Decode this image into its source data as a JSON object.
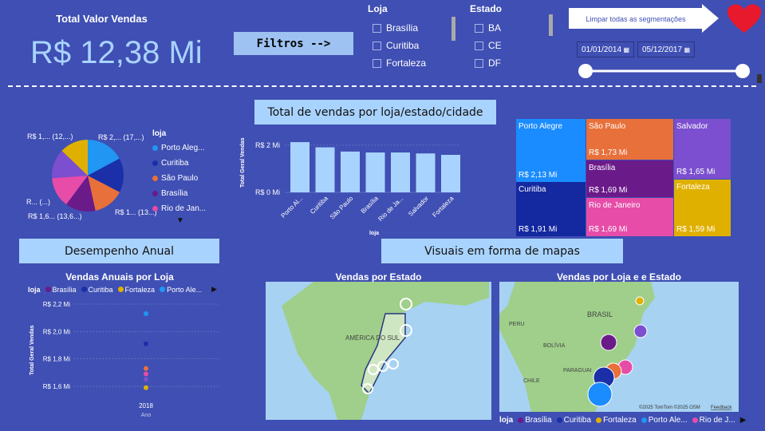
{
  "kpi": {
    "title": "Total Valor Vendas",
    "value": "R$ 12,38 Mi"
  },
  "filters_label": "Filtros -->",
  "slicer_loja": {
    "title": "Loja",
    "items": [
      "Brasília",
      "Curitiba",
      "Fortaleza"
    ]
  },
  "slicer_estado": {
    "title": "Estado",
    "items": [
      "BA",
      "CE",
      "DF"
    ]
  },
  "clear_button": "Limpar todas as segmentações",
  "date_from": "01/01/2014",
  "date_to": "05/12/2017",
  "sections": {
    "sales_by": "Total de vendas por loja/estado/cidade",
    "annual": "Desempenho Anual",
    "maps": "Visuais em forma de mapas"
  },
  "pie": {
    "legend_title": "loja",
    "legend": [
      {
        "name": "Porto Aleg...",
        "color": "#2196f3"
      },
      {
        "name": "Curitiba",
        "color": "#1a2fa8"
      },
      {
        "name": "São Paulo",
        "color": "#e8703a"
      },
      {
        "name": "Brasília",
        "color": "#6b1a8a"
      },
      {
        "name": "Rio de Jan...",
        "color": "#e64ca8"
      }
    ],
    "labels": [
      "R$ 1,... (12,...)",
      "R$ 2,... (17,...)",
      "R... (...)",
      "R$ 1,6... (13,6...)",
      "R$ 1... (13...)"
    ]
  },
  "chart_data": [
    {
      "type": "bar",
      "categories": [
        "Porto Al...",
        "Curitiba",
        "São Paulo",
        "Brasília",
        "Rio de Ja...",
        "Salvador",
        "Fortaleza"
      ],
      "values": [
        2.13,
        1.91,
        1.73,
        1.69,
        1.69,
        1.65,
        1.59
      ],
      "xlabel": "loja",
      "ylabel": "Total Geral Vendas",
      "yticks": [
        "R$ 2 Mi",
        "R$ 0 Mi"
      ],
      "ylim": [
        0,
        2.2
      ]
    },
    {
      "type": "scatter",
      "title": "Vendas Anuais por Loja",
      "legend_title": "loja",
      "series": [
        {
          "name": "Brasília",
          "color": "#6b1a8a",
          "x": [
            "2018"
          ],
          "y": [
            1.69
          ]
        },
        {
          "name": "Curitiba",
          "color": "#1a2fa8",
          "x": [
            "2018"
          ],
          "y": [
            1.91
          ]
        },
        {
          "name": "Fortaleza",
          "color": "#e0b000",
          "x": [
            "2018"
          ],
          "y": [
            1.59
          ]
        },
        {
          "name": "Porto Ale...",
          "color": "#2196f3",
          "x": [
            "2018"
          ],
          "y": [
            2.13
          ]
        }
      ],
      "yticks": [
        "R$ 2,2 Mi",
        "R$ 2,0 Mi",
        "R$ 1,8 Mi",
        "R$ 1,6 Mi"
      ],
      "ylim": [
        1.55,
        2.25
      ],
      "xlabel": "Ano",
      "ylabel": "Total Geral Vendas"
    }
  ],
  "treemap": [
    {
      "name": "Porto Alegre",
      "value": "R$ 2,13 Mi",
      "color": "#1a8cff"
    },
    {
      "name": "Curitiba",
      "value": "R$ 1,91 Mi",
      "color": "#1428a0"
    },
    {
      "name": "São Paulo",
      "value": "R$ 1,73 Mi",
      "color": "#e8703a"
    },
    {
      "name": "Brasília",
      "value": "R$ 1,69 Mi",
      "color": "#6b1a8a"
    },
    {
      "name": "Rio de Janeiro",
      "value": "R$ 1,69 Mi",
      "color": "#e64ca8"
    },
    {
      "name": "Salvador",
      "value": "R$ 1,65 Mi",
      "color": "#7b4fcf"
    },
    {
      "name": "Fortaleza",
      "value": "R$ 1,59 Mi",
      "color": "#e0b000"
    }
  ],
  "maps": {
    "state_title": "Vendas por Estado",
    "store_title": "Vendas por Loja e e Estado",
    "label_brasil": "BRASIL",
    "label_america": "AMÉRICA DO SUL",
    "label_peru": "PERU",
    "label_bolivia": "BOLÍVIA",
    "label_paraguai": "PARAGUAI",
    "label_chile": "CHILE",
    "attribution": "©2025 TomTom ©2025 OSM",
    "feedback": "Feedback",
    "legend_title": "loja",
    "legend": [
      {
        "name": "Brasília",
        "color": "#6b1a8a"
      },
      {
        "name": "Curitiba",
        "color": "#1a2fa8"
      },
      {
        "name": "Fortaleza",
        "color": "#e0b000"
      },
      {
        "name": "Porto Ale...",
        "color": "#2196f3"
      },
      {
        "name": "Rio de J...",
        "color": "#e64ca8"
      }
    ]
  }
}
